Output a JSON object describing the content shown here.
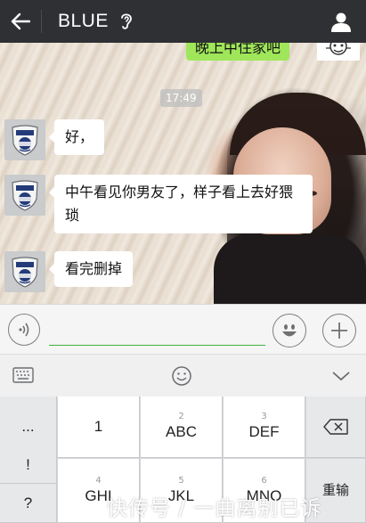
{
  "topbar": {
    "back_icon": "back-arrow-icon",
    "title": "BLUE",
    "ear_icon": "ear-icon",
    "profile_icon": "person-icon"
  },
  "chat": {
    "timestamp": "17:49",
    "sent_partial": "晚上中住家吧",
    "messages": [
      {
        "sender": "police-badge-avatar",
        "text": "好，"
      },
      {
        "sender": "police-badge-avatar",
        "text": "中午看见你男友了，样子看上去好猥琐"
      },
      {
        "sender": "police-badge-avatar",
        "text": "看完删掉"
      }
    ]
  },
  "input": {
    "voice_icon": "voice-icon",
    "text_value": "",
    "emoji_icon": "emoji-icon",
    "plus_icon": "plus-icon"
  },
  "keyboard_toolbar": {
    "switch_icon": "keyboard-icon",
    "smile_icon": "smile-icon",
    "collapse_icon": "chevron-down-icon"
  },
  "keyboard": {
    "side_keys": [
      "...",
      "!",
      "?"
    ],
    "keys": [
      {
        "num": "",
        "label": "1"
      },
      {
        "num": "2",
        "label": "ABC"
      },
      {
        "num": "3",
        "label": "DEF"
      },
      {
        "num": "4",
        "label": "GHI"
      },
      {
        "num": "5",
        "label": "JKL"
      },
      {
        "num": "6",
        "label": "MNO"
      }
    ],
    "delete_icon": "backspace-icon",
    "retype_label": "重输"
  },
  "watermark": "快传号 / 一曲离别已诉"
}
